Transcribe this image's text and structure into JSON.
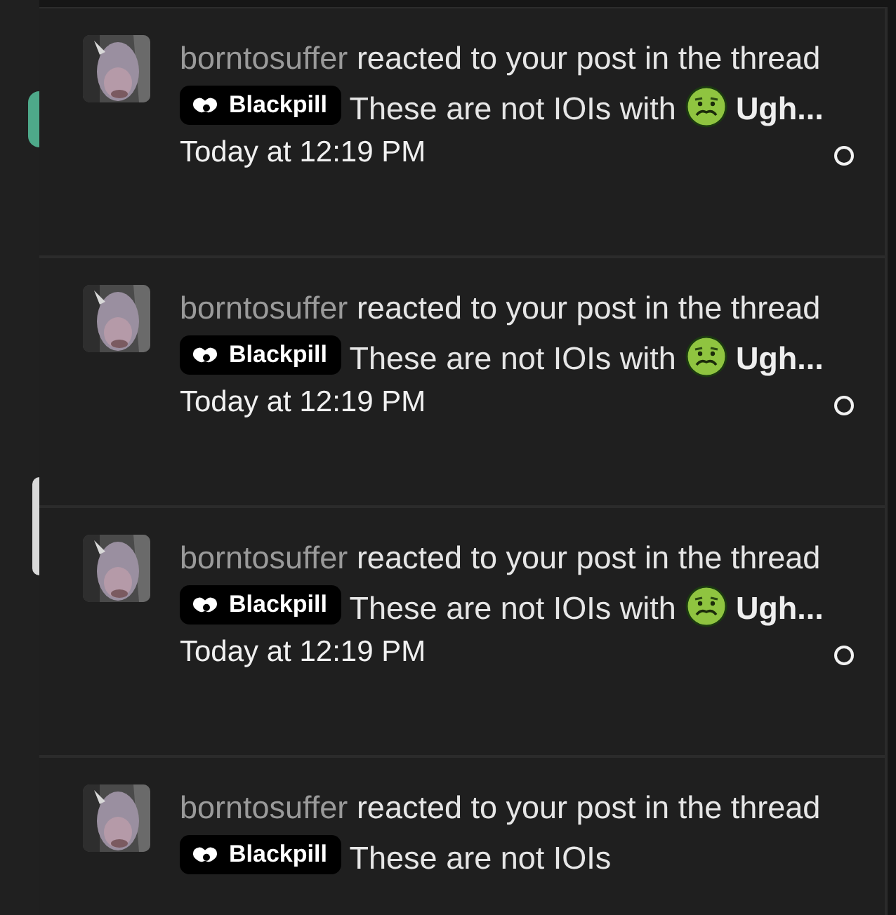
{
  "notifications": [
    {
      "username": "borntosuffer",
      "action": "reacted to your post in the thread",
      "tag": "Blackpill",
      "title": "These are not IOIs",
      "connector": "with",
      "reaction": "Ugh...",
      "time": "Today at 12:19 PM",
      "unread": true
    },
    {
      "username": "borntosuffer",
      "action": "reacted to your post in the thread",
      "tag": "Blackpill",
      "title": "These are not IOIs",
      "connector": "with",
      "reaction": "Ugh...",
      "time": "Today at 12:19 PM",
      "unread": true
    },
    {
      "username": "borntosuffer",
      "action": "reacted to your post in the thread",
      "tag": "Blackpill",
      "title": "These are not IOIs",
      "connector": "with",
      "reaction": "Ugh...",
      "time": "Today at 12:19 PM",
      "unread": true
    },
    {
      "username": "borntosuffer",
      "action": "reacted to your post in the thread",
      "tag": "Blackpill",
      "title": "These are not IOIs"
    }
  ]
}
